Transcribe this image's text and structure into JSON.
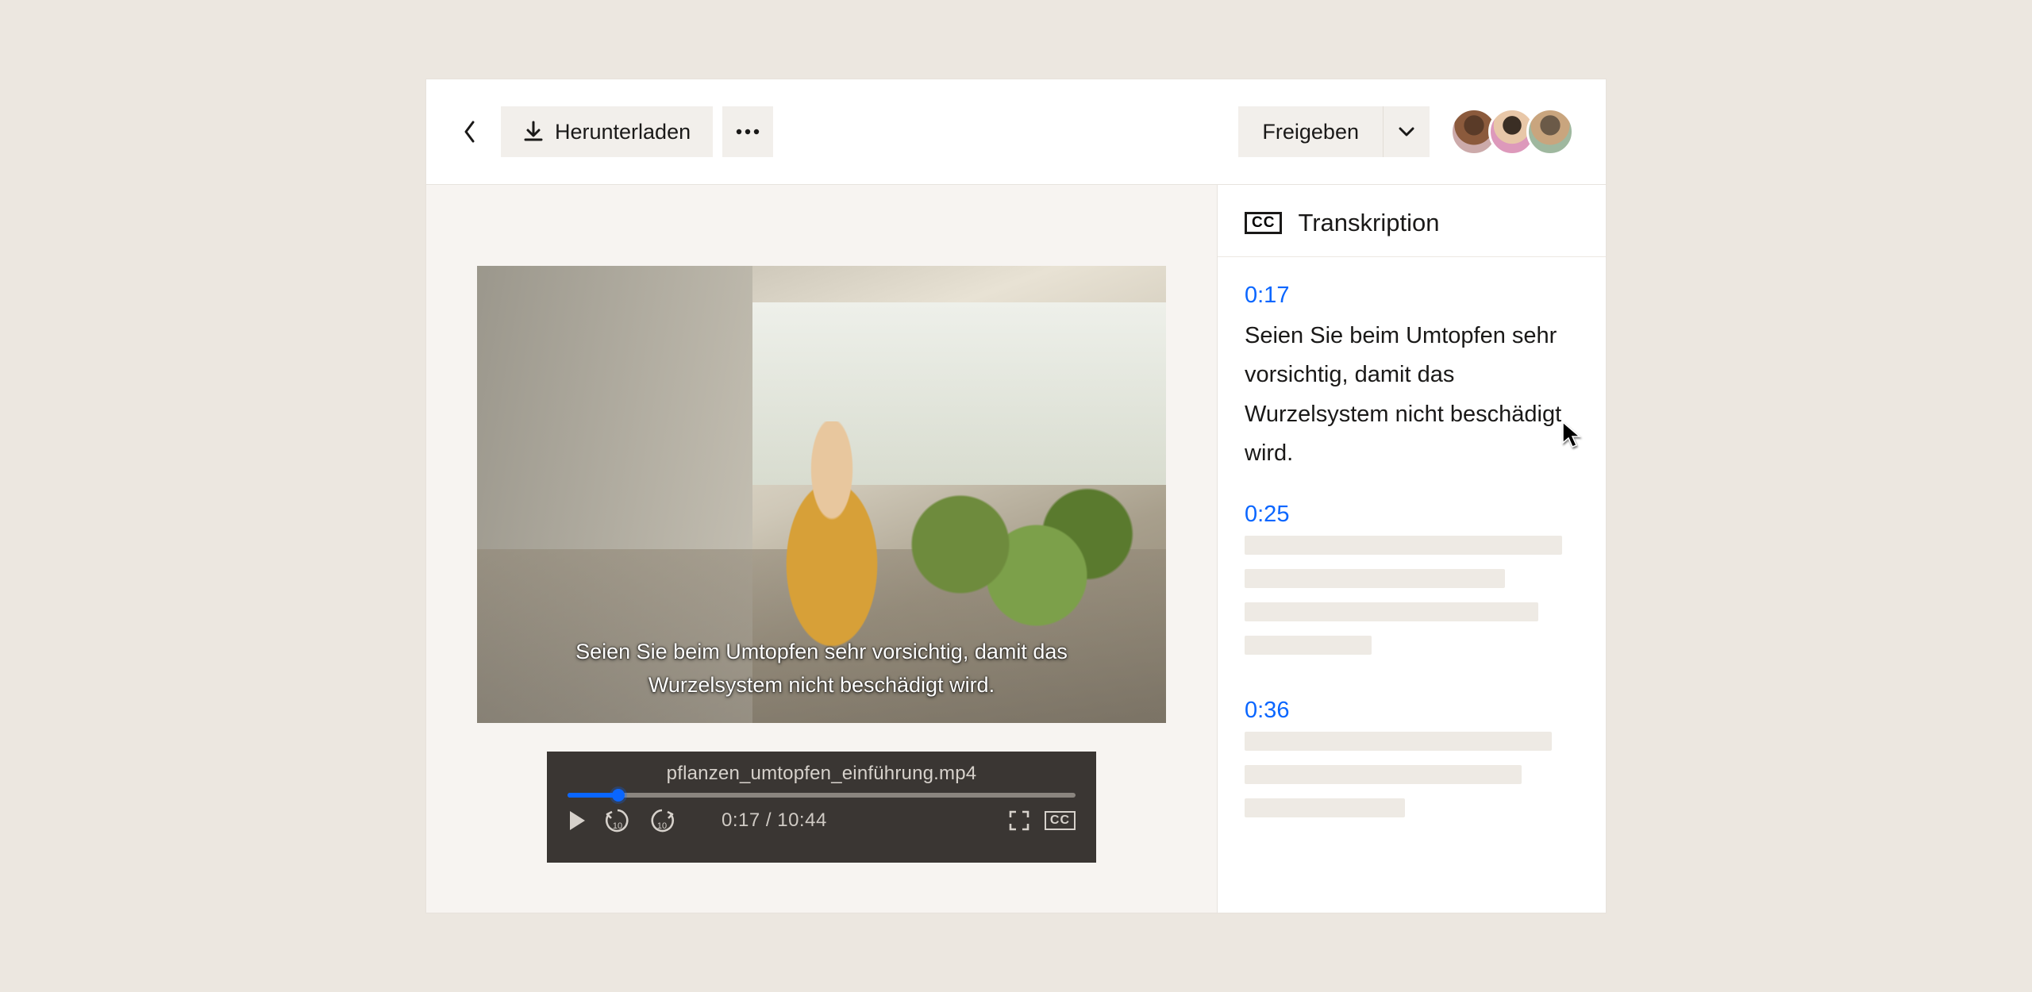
{
  "toolbar": {
    "download_label": "Herunterladen",
    "share_label": "Freigeben"
  },
  "video": {
    "caption": "Seien Sie beim Umtopfen sehr vorsichtig, damit das Wurzelsystem nicht beschädigt wird.",
    "filename": "pflanzen_umtopfen_einführung.mp4",
    "current_time": "0:17",
    "duration": "10:44",
    "progress_pct": 10,
    "skip_back_label": "10",
    "skip_fwd_label": "10"
  },
  "transcript": {
    "title": "Transkription",
    "segments": [
      {
        "time": "0:17",
        "text": "Seien Sie beim Umtopfen sehr vorsichtig, damit das Wurzelsystem nicht beschädigt wird."
      },
      {
        "time": "0:25",
        "text": ""
      },
      {
        "time": "0:36",
        "text": ""
      }
    ]
  }
}
